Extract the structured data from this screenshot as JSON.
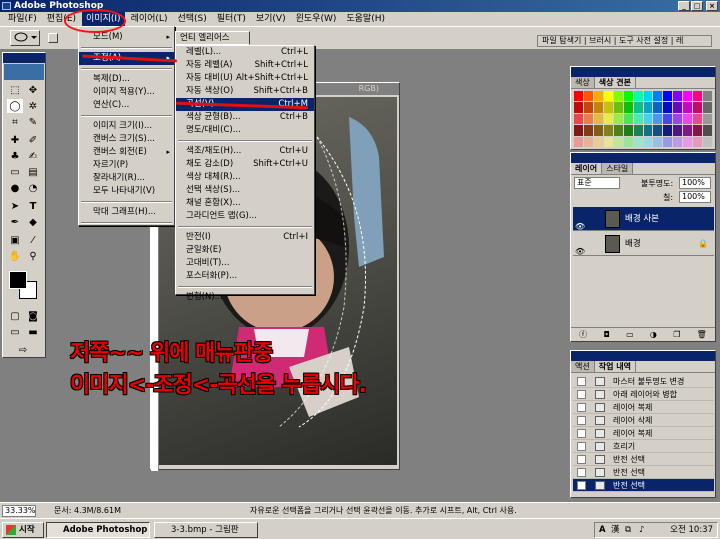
{
  "window": {
    "title": "Adobe Photoshop",
    "min": "_",
    "max": "□",
    "close": "×"
  },
  "menubar": [
    {
      "label": "파일(F)"
    },
    {
      "label": "편집(E)"
    },
    {
      "label": "이미지(I)"
    },
    {
      "label": "레이어(L)"
    },
    {
      "label": "선택(S)"
    },
    {
      "label": "필터(T)"
    },
    {
      "label": "보기(V)"
    },
    {
      "label": "윈도우(W)"
    },
    {
      "label": "도움말(H)"
    }
  ],
  "palette_well": {
    "label": "파일 탐색기 | 브러시 | 도구 사전 설정 | 레"
  },
  "document": {
    "title": "RGB)"
  },
  "image_menu": {
    "items": [
      {
        "label": "모드(M)",
        "arrow": "▸"
      },
      {
        "label": "조정(A)",
        "arrow": "▸"
      },
      {
        "label": "복제(D)..."
      },
      {
        "label": "이미지 적용(Y)..."
      },
      {
        "label": "연산(C)..."
      },
      {
        "label": "이미지 크기(I)..."
      },
      {
        "label": "캔버스 크기(S)..."
      },
      {
        "label": "캔버스 회전(E)",
        "arrow": "▸"
      },
      {
        "label": "자르기(P)"
      },
      {
        "label": "잘라내기(R)..."
      },
      {
        "label": "모두 나타내기(V)"
      },
      {
        "label": "막대 그래프(H)..."
      },
      {
        "label": "트랩(T)..."
      }
    ]
  },
  "adjust_topitem": {
    "label": "언티 엘리어스"
  },
  "adjust_menu": {
    "items": [
      {
        "label": "레벨(L)...",
        "sc": "Ctrl+L"
      },
      {
        "label": "자동 레벨(A)",
        "sc": "Shift+Ctrl+L"
      },
      {
        "label": "자동 대비(U)",
        "sc": "Alt+Shift+Ctrl+L"
      },
      {
        "label": "자동 색상(O)",
        "sc": "Shift+Ctrl+B"
      },
      {
        "label": "곡선(V)...",
        "sc": "Ctrl+M"
      },
      {
        "label": "색상 균형(B)...",
        "sc": "Ctrl+B"
      },
      {
        "label": "명도/대비(C)..."
      },
      {
        "label": "색조/채도(H)...",
        "sc": "Ctrl+U"
      },
      {
        "label": "채도 감소(D)",
        "sc": "Shift+Ctrl+U"
      },
      {
        "label": "색상 대체(R)..."
      },
      {
        "label": "선택 색상(S)..."
      },
      {
        "label": "채널 혼합(X)..."
      },
      {
        "label": "그라디언트 맵(G)..."
      },
      {
        "label": "반전(I)",
        "sc": "Ctrl+I"
      },
      {
        "label": "균일화(E)"
      },
      {
        "label": "고대비(T)..."
      },
      {
        "label": "포스터화(P)..."
      },
      {
        "label": "변형(N)..."
      }
    ]
  },
  "color_panel": {
    "tabs": [
      "색상",
      "색상 견본"
    ]
  },
  "layers_panel": {
    "tabs": [
      "레이어",
      "스타일"
    ],
    "blend": "표준",
    "opacity_label": "불투명도:",
    "opacity": "100%",
    "fill_label": "칠:",
    "fill": "100%",
    "layers": [
      {
        "name": "배경 사본",
        "selected": true
      },
      {
        "name": "배경",
        "selected": false
      }
    ]
  },
  "history_panel": {
    "tabs": [
      "액션",
      "작업 내역"
    ],
    "rows": [
      {
        "label": "마스터 불투명도 변경"
      },
      {
        "label": "아래 레이어와 병합"
      },
      {
        "label": "레이어 복제"
      },
      {
        "label": "레이어 삭제"
      },
      {
        "label": "레이어 복제"
      },
      {
        "label": "흐리기"
      },
      {
        "label": "반전 선택"
      },
      {
        "label": "반전 선택"
      },
      {
        "label": "반전 선택"
      }
    ]
  },
  "annotation": {
    "line1": "저쪽~~ 위에 매뉴판중",
    "line2": "이미지<-조정<-곡선을 누릅시다."
  },
  "statusbar": {
    "zoom": "33.33%",
    "doc": "문서: 4.3M/8.61M",
    "hint": "자유로운 선택폼을 그리거나 선택 윤곽선을 이동. 추가로 시프트, Alt, Ctrl 사용."
  },
  "taskbar": {
    "start": "시작",
    "tasks": [
      {
        "label": "Adobe Photoshop"
      },
      {
        "label": "3-3.bmp - 그림판"
      }
    ],
    "clock": "오전 10:37"
  }
}
